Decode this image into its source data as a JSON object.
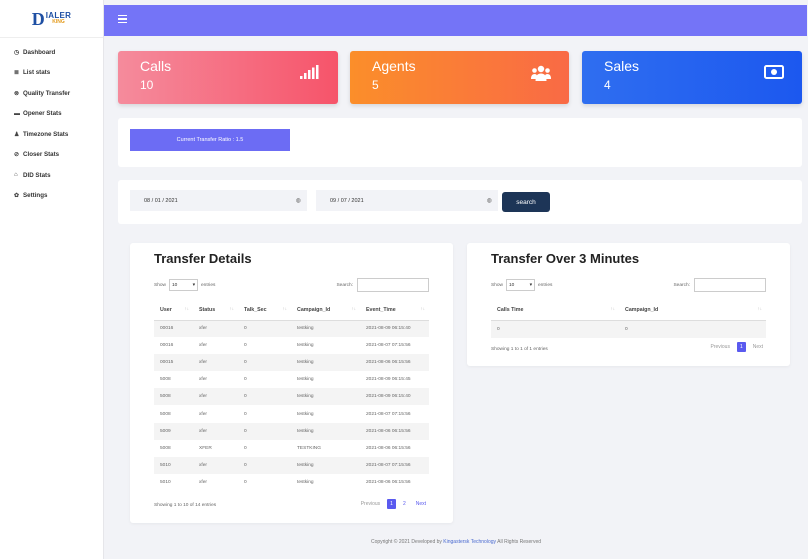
{
  "brand": {
    "mark": "D",
    "name": "IALER",
    "sub": "KING"
  },
  "sidebar": {
    "items": [
      {
        "label": "Dashboard",
        "icon": "◷"
      },
      {
        "label": "List stats",
        "icon": "≣"
      },
      {
        "label": "Quality Transfer",
        "icon": "⊗"
      },
      {
        "label": "Opener Stats",
        "icon": "▬"
      },
      {
        "label": "Timezone Stats",
        "icon": "♟"
      },
      {
        "label": "Closer Stats",
        "icon": "⊘"
      },
      {
        "label": "DID Stats",
        "icon": "⌂"
      },
      {
        "label": "Settings",
        "icon": "✿"
      }
    ]
  },
  "cards": {
    "calls": {
      "label": "Calls",
      "value": "10",
      "icon": "signal-icon"
    },
    "agents": {
      "label": "Agents",
      "value": "5",
      "icon": "users-icon"
    },
    "sales": {
      "label": "Sales",
      "value": "4",
      "icon": "money-icon"
    }
  },
  "ratio": {
    "text": "Current Transfer Ratio : 1.5"
  },
  "dates": {
    "from": "08 / 01 / 2021",
    "to": "09 / 07 / 2021",
    "search_label": "search"
  },
  "transfer": {
    "title": "Transfer Details",
    "show": "Show",
    "entries_value": "10",
    "entries": "entries",
    "search": "Search:",
    "columns": [
      "User",
      "Status",
      "Talk_Sec",
      "Campaign_Id",
      "Event_Time"
    ],
    "rows": [
      [
        "00016",
        "xfer",
        "0",
        "testking",
        "2021-08-09 06:15:40"
      ],
      [
        "00016",
        "xfer",
        "0",
        "testking",
        "2021-08-07 07:15:56"
      ],
      [
        "00015",
        "xfer",
        "0",
        "testking",
        "2021-08-06 06:15:56"
      ],
      [
        "5008",
        "xfer",
        "0",
        "testking",
        "2021-08-09 06:15:45"
      ],
      [
        "5008",
        "xfer",
        "0",
        "testking",
        "2021-08-09 06:15:40"
      ],
      [
        "5008",
        "xfer",
        "0",
        "testking",
        "2021-08-07 07:15:56"
      ],
      [
        "5009",
        "xfer",
        "0",
        "testking",
        "2021-08-06 06:15:56"
      ],
      [
        "5008",
        "XFER",
        "0",
        "TESTKING",
        "2021-08-06 06:15:56"
      ],
      [
        "5010",
        "xfer",
        "0",
        "testking",
        "2021-08-07 07:15:56"
      ],
      [
        "5010",
        "xfer",
        "0",
        "testking",
        "2021-08-06 06:15:56"
      ]
    ],
    "info": "Showing 1 to 10 of 14 entries",
    "prev": "Previous",
    "p1": "1",
    "p2": "2",
    "next": "Next"
  },
  "over3": {
    "title": "Transfer Over 3 Minutes",
    "show": "Show",
    "entries_value": "10",
    "entries": "entries",
    "search": "Search:",
    "columns": [
      "Calls Time",
      "Campaign_Id"
    ],
    "rows": [
      [
        "0",
        "0"
      ]
    ],
    "info": "Showing 1 to 1 of 1 entries",
    "prev": "Previous",
    "p1": "1",
    "next": "Next"
  },
  "footer": {
    "prefix": "Copyright © 2021 Developed by ",
    "link": "Kingastersk Technology",
    "suffix": " All Rights Reserved"
  },
  "colors": {
    "topbar": "#7474f7",
    "calls": "#f6546a",
    "agents": "#fb8e2a",
    "sales": "#1c58ef",
    "ratio": "#6c6cf4",
    "search_button": "#1d3557"
  }
}
